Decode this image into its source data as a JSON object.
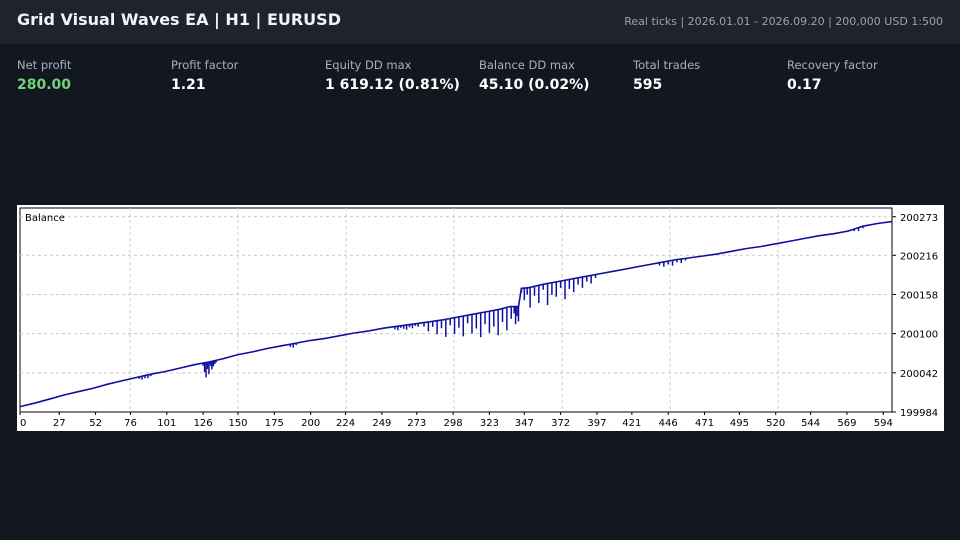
{
  "header": {
    "title": "Grid Visual Waves EA  |  H1  |  EURUSD",
    "meta": "Real ticks  |  2026.01.01 - 2026.09.20  |  200,000 USD  1:500"
  },
  "stats": [
    {
      "label": "Net profit",
      "value": "280.00",
      "color": "#6fd57a"
    },
    {
      "label": "Profit factor",
      "value": "1.21"
    },
    {
      "label": "Equity DD max",
      "value": "1 619.12 (0.81%)"
    },
    {
      "label": "Balance DD max",
      "value": "45.10 (0.02%)"
    },
    {
      "label": "Total trades",
      "value": "595"
    },
    {
      "label": "Recovery factor",
      "value": "0.17"
    }
  ],
  "chart_data": {
    "type": "line",
    "title": "Balance",
    "xlabel": "",
    "ylabel": "",
    "x_ticks": [
      0,
      27,
      52,
      76,
      101,
      126,
      150,
      175,
      200,
      224,
      249,
      273,
      298,
      323,
      347,
      372,
      397,
      421,
      446,
      471,
      495,
      520,
      544,
      569,
      594
    ],
    "y_ticks": [
      199984,
      200042,
      200100,
      200158,
      200216,
      200273
    ],
    "xlim": [
      0,
      600
    ],
    "ylim": [
      199984,
      200286
    ],
    "grid": true,
    "line_color": "#1010a0",
    "series": [
      {
        "x": [
          0,
          10,
          20,
          30,
          40,
          50,
          60,
          70,
          80,
          90,
          100,
          110,
          120,
          130,
          140,
          145,
          150,
          160,
          170,
          180,
          190,
          200,
          210,
          220,
          230,
          240,
          250,
          260,
          270,
          280,
          290,
          300,
          310,
          320,
          330,
          337,
          340,
          343,
          345,
          350,
          360,
          370,
          380,
          390,
          400,
          410,
          420,
          430,
          440,
          450,
          460,
          470,
          480,
          490,
          500,
          510,
          520,
          530,
          540,
          550,
          560,
          570,
          580,
          590,
          600
        ],
        "y": [
          199992,
          199997,
          200003,
          200009,
          200014,
          200019,
          200025,
          200030,
          200035,
          200040,
          200044,
          200049,
          200054,
          200058,
          200063,
          200066,
          200069,
          200073,
          200078,
          200082,
          200086,
          200090,
          200093,
          200097,
          200101,
          200104,
          200108,
          200111,
          200114,
          200117,
          200120,
          200124,
          200128,
          200132,
          200136,
          200140,
          200140,
          200140,
          200167,
          200168,
          200173,
          200177,
          200181,
          200185,
          200189,
          200193,
          200197,
          200201,
          200205,
          200209,
          200212,
          200215,
          200218,
          200222,
          200226,
          200229,
          200233,
          200237,
          200241,
          200245,
          200248,
          200252,
          200259,
          200263,
          200266
        ]
      }
    ],
    "spikes": [
      {
        "x": [
          82,
          84,
          86,
          88,
          90
        ],
        "depth": [
          3,
          5,
          4,
          5,
          3
        ]
      },
      {
        "x": [
          126,
          127,
          128,
          129,
          130,
          131,
          132,
          133,
          134,
          135
        ],
        "depth": [
          4,
          14,
          22,
          10,
          18,
          6,
          12,
          8,
          5,
          3
        ]
      },
      {
        "x": [
          186,
          188,
          190
        ],
        "depth": [
          4,
          6,
          3
        ]
      },
      {
        "x": [
          258,
          260,
          262,
          264,
          266,
          268,
          270,
          272,
          274
        ],
        "depth": [
          4,
          6,
          3,
          5,
          7,
          4,
          6,
          3,
          5
        ]
      },
      {
        "x": [
          278,
          281,
          284,
          287,
          290,
          293,
          296,
          299,
          302,
          305,
          308,
          311,
          314,
          317,
          320,
          323,
          326,
          329,
          332,
          335,
          338,
          340,
          341,
          342,
          343
        ],
        "depth": [
          6,
          14,
          8,
          20,
          12,
          26,
          10,
          24,
          16,
          30,
          12,
          28,
          22,
          36,
          18,
          32,
          24,
          38,
          20,
          34,
          18,
          10,
          26,
          14,
          22
        ]
      },
      {
        "x": [
          345,
          347,
          349,
          351,
          354,
          357,
          360,
          363,
          366,
          369,
          372,
          375,
          378,
          381,
          384,
          387,
          390,
          393,
          396
        ],
        "depth": [
          6,
          18,
          10,
          30,
          14,
          26,
          8,
          32,
          18,
          22,
          10,
          28,
          14,
          20,
          10,
          16,
          8,
          12,
          5
        ]
      },
      {
        "x": [
          440,
          443,
          446,
          449,
          452,
          455,
          458
        ],
        "depth": [
          4,
          7,
          5,
          8,
          4,
          6,
          3
        ]
      },
      {
        "x": [
          574,
          577,
          580
        ],
        "depth": [
          3,
          5,
          3
        ]
      }
    ]
  }
}
